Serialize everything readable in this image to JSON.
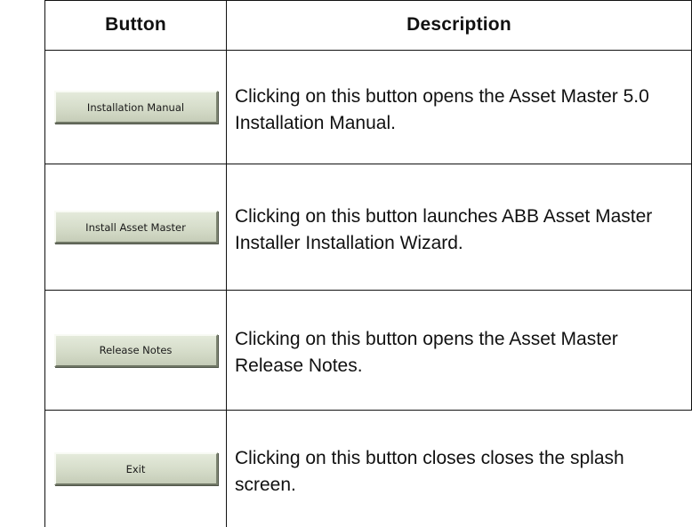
{
  "table": {
    "headers": {
      "button": "Button",
      "description": "Description"
    },
    "rows": [
      {
        "button_label": "Installation Manual",
        "description": "Clicking on this button opens the Asset Master 5.0 Installation Manual."
      },
      {
        "button_label": "Install Asset Master",
        "description": "Clicking on this button launches ABB Asset Master Installer Installation Wizard."
      },
      {
        "button_label": "Release Notes",
        "description": "Clicking on this button opens the Asset Master Release Notes."
      },
      {
        "button_label": "Exit",
        "description": "Clicking on this button closes closes the splash screen."
      }
    ]
  }
}
